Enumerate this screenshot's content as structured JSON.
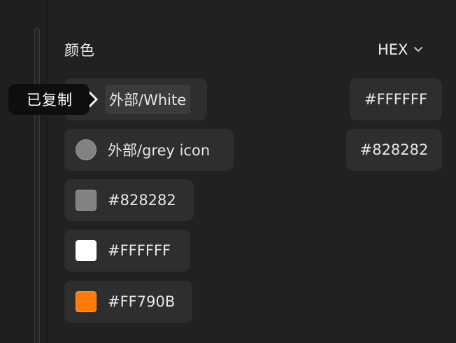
{
  "panel": {
    "title": "颜色",
    "format": "HEX"
  },
  "tooltip": {
    "text": "已复制"
  },
  "styles": [
    {
      "name": "外部/White",
      "color": "#FFFFFF"
    },
    {
      "name": "外部/grey icon",
      "color": "#828282"
    }
  ],
  "style_values": [
    {
      "hex": "#FFFFFF"
    },
    {
      "hex": "#828282"
    }
  ],
  "colors": [
    {
      "hex": "#828282",
      "color": "#828282"
    },
    {
      "hex": "#FFFFFF",
      "color": "#FFFFFF"
    },
    {
      "hex": "#FF790B",
      "color": "#FF790B"
    }
  ],
  "icons": {
    "format_dropdown": "chevron-down-icon",
    "color_swatch": "color-swatch-icon"
  }
}
